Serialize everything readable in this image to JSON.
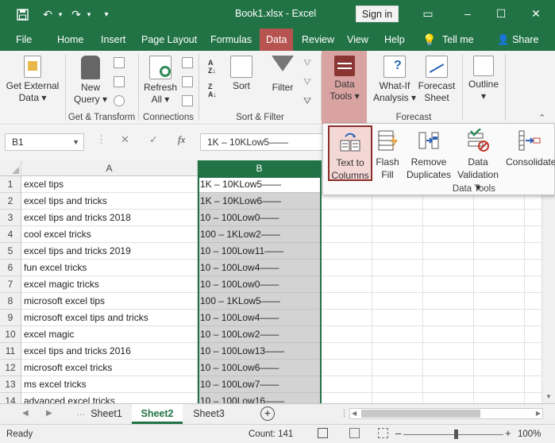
{
  "titlebar": {
    "title": "Book1.xlsx  -  Excel",
    "signin": "Sign in"
  },
  "menu": [
    "File",
    "Home",
    "Insert",
    "Page Layout",
    "Formulas",
    "Data",
    "Review",
    "View",
    "Help",
    "Tell me",
    "Share"
  ],
  "ribbon": {
    "get_external": [
      "Get External",
      "Data ▾"
    ],
    "new_query": [
      "New",
      "Query ▾"
    ],
    "refresh": [
      "Refresh",
      "All ▾"
    ],
    "sort": "Sort",
    "filter": "Filter",
    "data_tools": [
      "Data",
      "Tools ▾"
    ],
    "what_if": [
      "What-If",
      "Analysis ▾"
    ],
    "forecast_sheet": [
      "Forecast",
      "Sheet"
    ],
    "outline": [
      "Outline",
      "▾"
    ],
    "group_labels": {
      "get_transform": "Get & Transform",
      "connections": "Connections",
      "sort_filter": "Sort & Filter",
      "forecast": "Forecast"
    }
  },
  "formula_bar": {
    "name_box": "B1",
    "fx": "fx",
    "value": "1K – 10KLow5——"
  },
  "panel": {
    "items": [
      [
        "Text to",
        "Columns"
      ],
      [
        "Flash",
        "Fill"
      ],
      [
        "Remove",
        "Duplicates"
      ],
      [
        "Data",
        "Validation ▾"
      ],
      [
        "Consolidate",
        ""
      ]
    ],
    "group_name": "Data Tools"
  },
  "grid": {
    "columns": [
      "A",
      "B"
    ],
    "rows": [
      {
        "n": "1",
        "a": "excel tips",
        "b": "1K – 10KLow5——"
      },
      {
        "n": "2",
        "a": "excel tips and tricks",
        "b": "1K – 10KLow6——"
      },
      {
        "n": "3",
        "a": "excel tips and tricks 2018",
        "b": "10 – 100Low0——"
      },
      {
        "n": "4",
        "a": "cool excel tricks",
        "b": "100 – 1KLow2——"
      },
      {
        "n": "5",
        "a": "excel tips and tricks 2019",
        "b": "10 – 100Low11——"
      },
      {
        "n": "6",
        "a": "fun excel tricks",
        "b": "10 – 100Low4——"
      },
      {
        "n": "7",
        "a": "excel magic tricks",
        "b": "10 – 100Low0——"
      },
      {
        "n": "8",
        "a": "microsoft excel tips",
        "b": "100 – 1KLow5——"
      },
      {
        "n": "9",
        "a": "microsoft excel tips and tricks",
        "b": "10 – 100Low4——"
      },
      {
        "n": "10",
        "a": "excel magic",
        "b": "10 – 100Low2——"
      },
      {
        "n": "11",
        "a": "excel tips and tricks 2016",
        "b": "10 – 100Low13——"
      },
      {
        "n": "12",
        "a": "microsoft excel tricks",
        "b": "10 – 100Low6——"
      },
      {
        "n": "13",
        "a": "ms excel tricks",
        "b": "10 – 100Low7——"
      },
      {
        "n": "14",
        "a": "advanced excel tricks",
        "b": "10 – 100Low16——"
      }
    ]
  },
  "sheets": [
    "Sheet1",
    "Sheet2",
    "Sheet3"
  ],
  "active_sheet": "Sheet2",
  "status": {
    "ready": "Ready",
    "count": "Count: 141",
    "zoom": "100%"
  },
  "colors": {
    "brand": "#217346",
    "data_tab": "#b85450"
  }
}
